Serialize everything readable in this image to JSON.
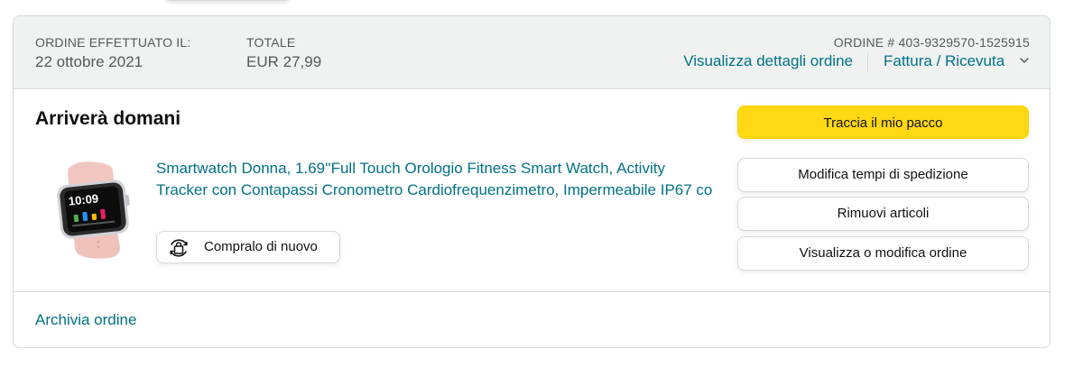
{
  "header": {
    "order_placed_label": "ORDINE EFFETTUATO IL:",
    "order_date": "22 ottobre 2021",
    "total_label": "TOTALE",
    "total_value": "EUR 27,99",
    "order_number_label": "ORDINE # 403-9329570-1525915",
    "details_link": "Visualizza dettagli ordine",
    "invoice_link": "Fattura / Ricevuta"
  },
  "shipment": {
    "status_title": "Arriverà domani"
  },
  "product": {
    "title": "Smartwatch Donna, 1.69''Full Touch Orologio Fitness Smart Watch, Activity Tracker con Contapassi Cronometro Cardiofrequenzimetro, Impermeabile IP67 co",
    "image_icon": "pink-smartwatch-image",
    "watch_time": "10:09",
    "buy_again_label": "Compralo di nuovo",
    "buy_again_icon": "buy-again-icon"
  },
  "actions": {
    "track": "Traccia il mio pacco",
    "change_delivery": "Modifica tempi di spedizione",
    "remove_items": "Rimuovi articoli",
    "view_edit_order": "Visualizza o modifica ordine"
  },
  "footer": {
    "archive_link": "Archivia ordine"
  },
  "colors": {
    "link": "#007185",
    "primary_button": "#ffd814",
    "header_bg": "#f0f2f2",
    "border": "#d5d9d9",
    "text": "#0f1111",
    "muted_text": "#565959"
  }
}
